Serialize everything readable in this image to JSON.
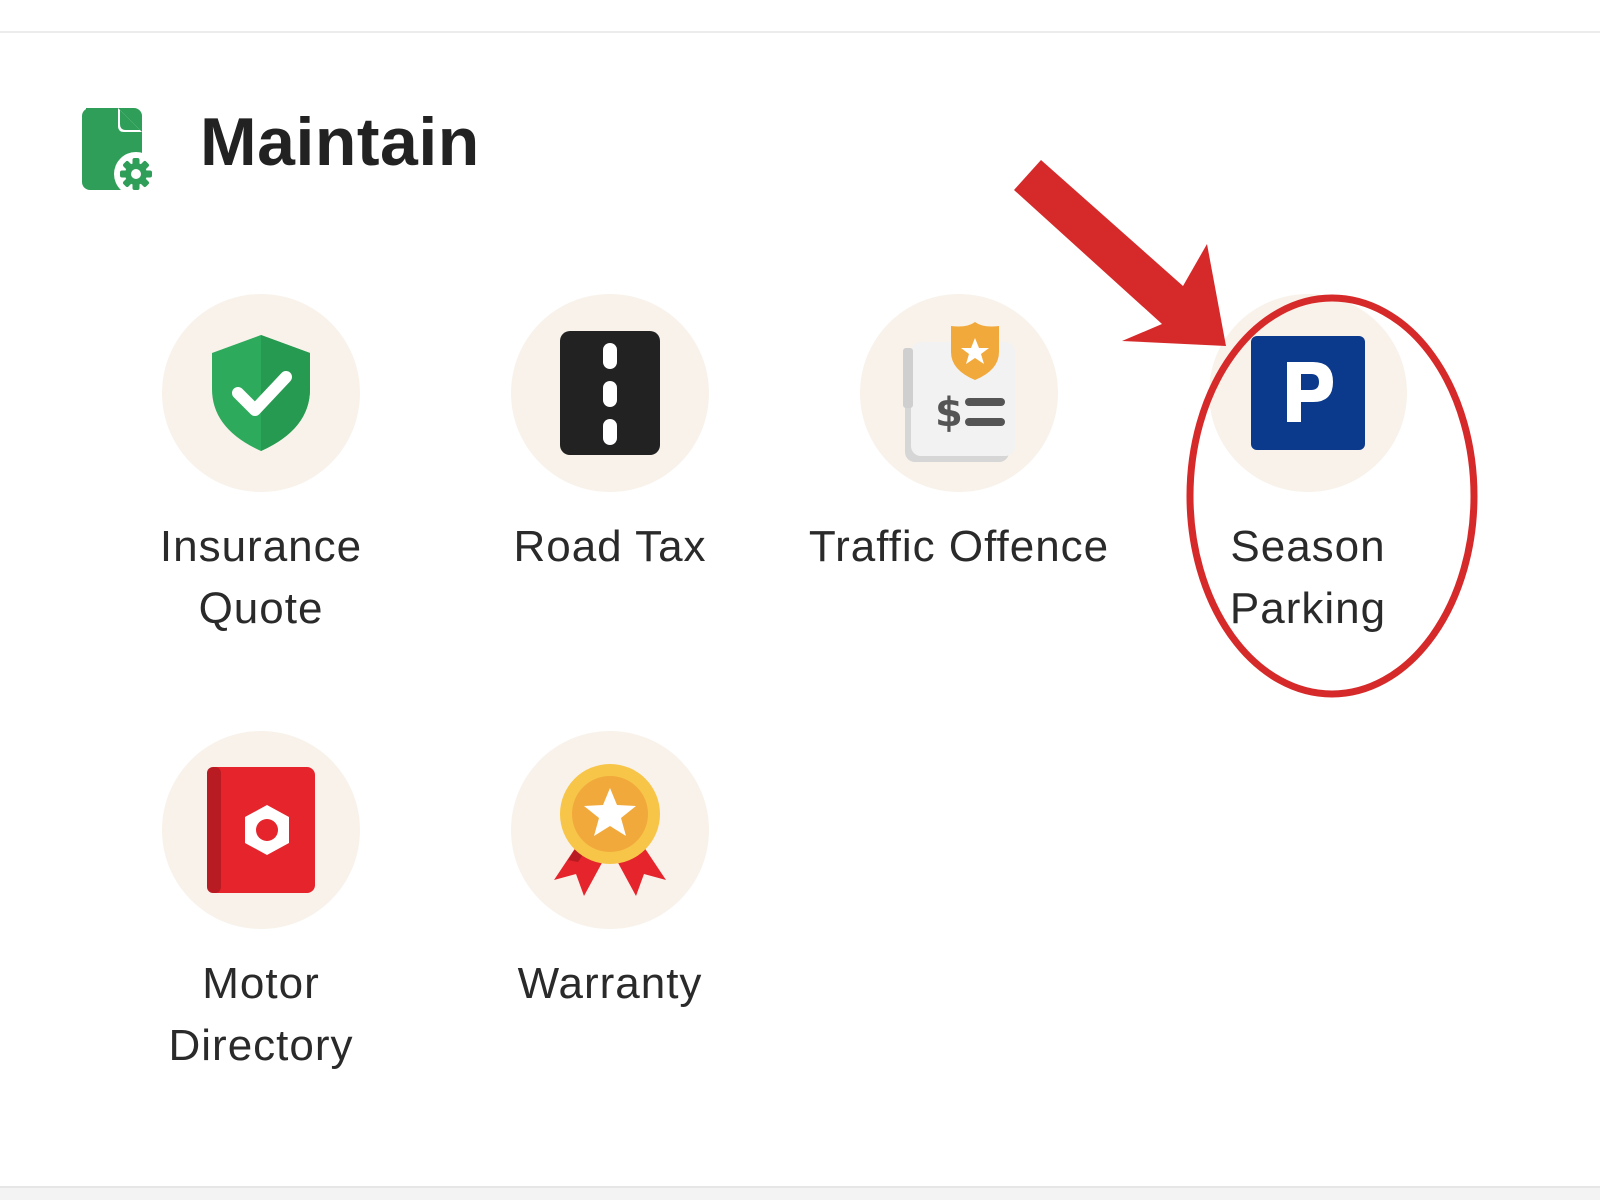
{
  "section": {
    "title": "Maintain",
    "icon": "document-gear-icon"
  },
  "tiles": [
    {
      "label_line1": "Insurance",
      "label_line2": "Quote",
      "icon": "shield-check-icon"
    },
    {
      "label_line1": "Road Tax",
      "label_line2": "",
      "icon": "road-icon"
    },
    {
      "label_line1": "Traffic Offence",
      "label_line2": "",
      "icon": "traffic-ticket-icon"
    },
    {
      "label_line1": "Season",
      "label_line2": "Parking",
      "icon": "parking-icon"
    },
    {
      "label_line1": "Motor",
      "label_line2": "Directory",
      "icon": "directory-book-icon"
    },
    {
      "label_line1": "Warranty",
      "label_line2": "",
      "icon": "medal-ribbon-icon"
    }
  ],
  "colors": {
    "header_icon_green": "#2e9e58",
    "shield_green": "#2eaa5c",
    "parking_blue": "#0b3a8c",
    "directory_red": "#e5242c",
    "annotation_red": "#d62a2a",
    "bubble_bg": "#f8f2ea"
  }
}
